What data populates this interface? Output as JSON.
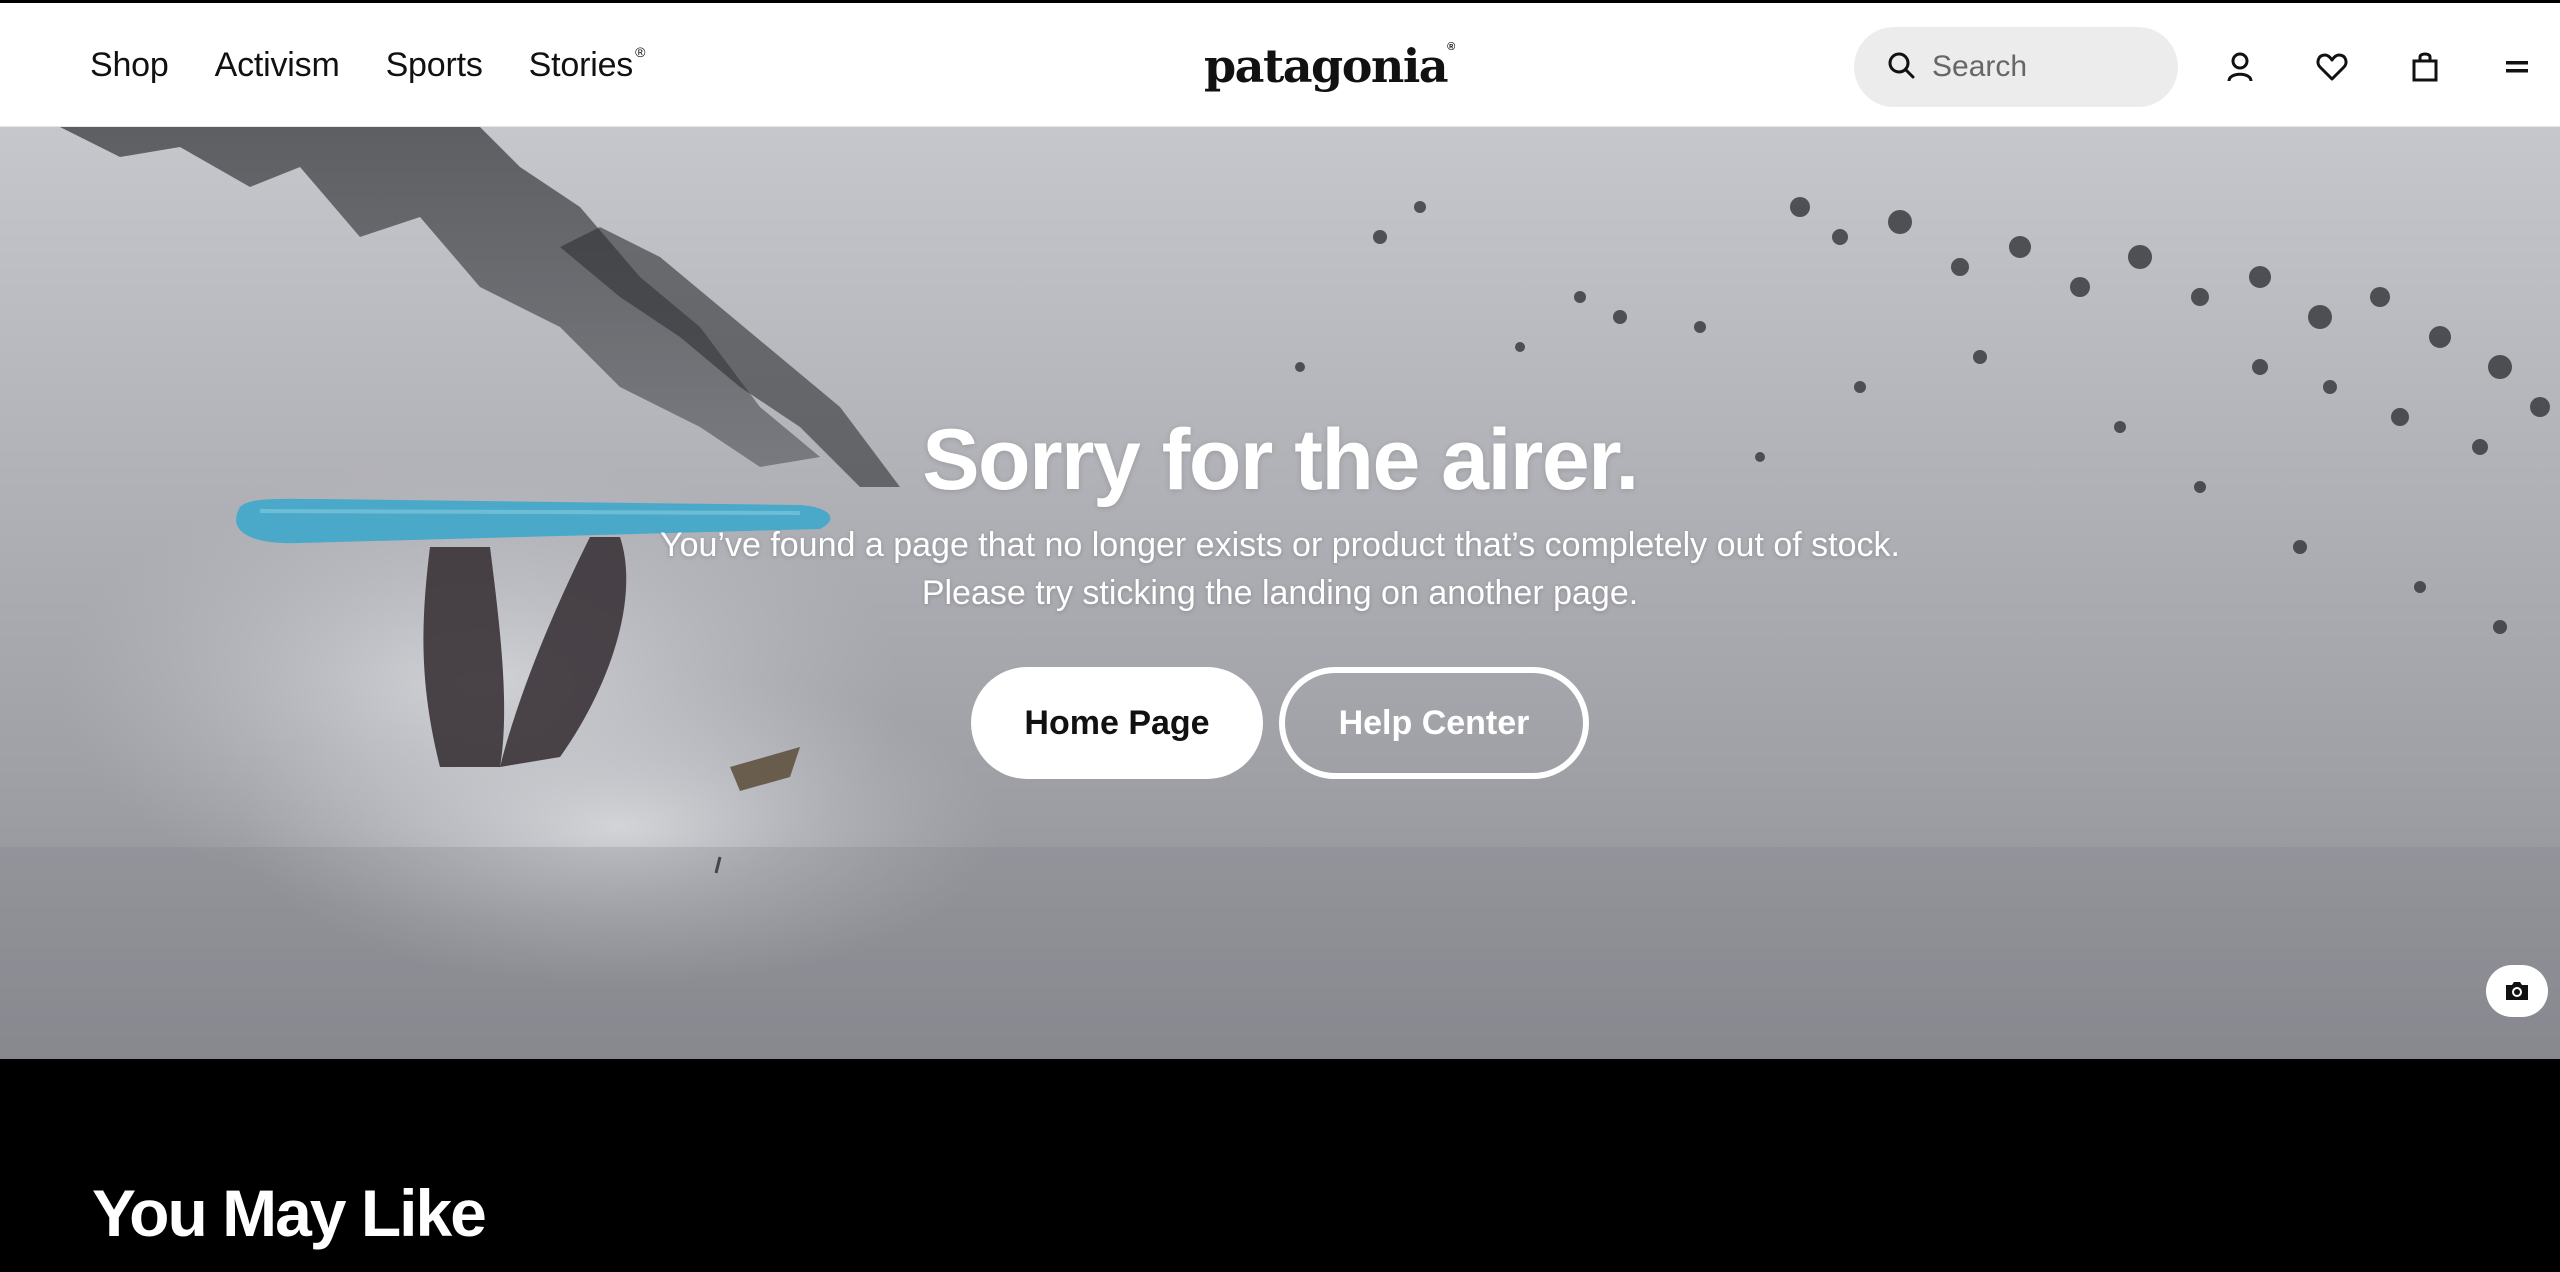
{
  "header": {
    "nav": [
      {
        "label": "Shop"
      },
      {
        "label": "Activism"
      },
      {
        "label": "Sports"
      },
      {
        "label": "Stories",
        "mark": "®"
      }
    ],
    "logo_text": "patagonia",
    "logo_mark": "®",
    "search": {
      "placeholder": "Search",
      "value": ""
    },
    "icons": [
      "account-icon",
      "heart-icon",
      "bag-icon",
      "menu-icon"
    ]
  },
  "hero": {
    "title": "Sorry for the airer.",
    "text": "You’ve found a page that no longer exists or product that’s completely out of stock. Please try sticking the landing on another page.",
    "buttons": {
      "home": "Home Page",
      "help": "Help Center"
    },
    "photo_credit_icon": "camera-icon"
  },
  "section": {
    "heading": "You May Like"
  },
  "colors": {
    "header_bg": "#ffffff",
    "search_bg": "#ececec",
    "section_bg": "#000000",
    "snowboard": "#4aa9c9"
  }
}
